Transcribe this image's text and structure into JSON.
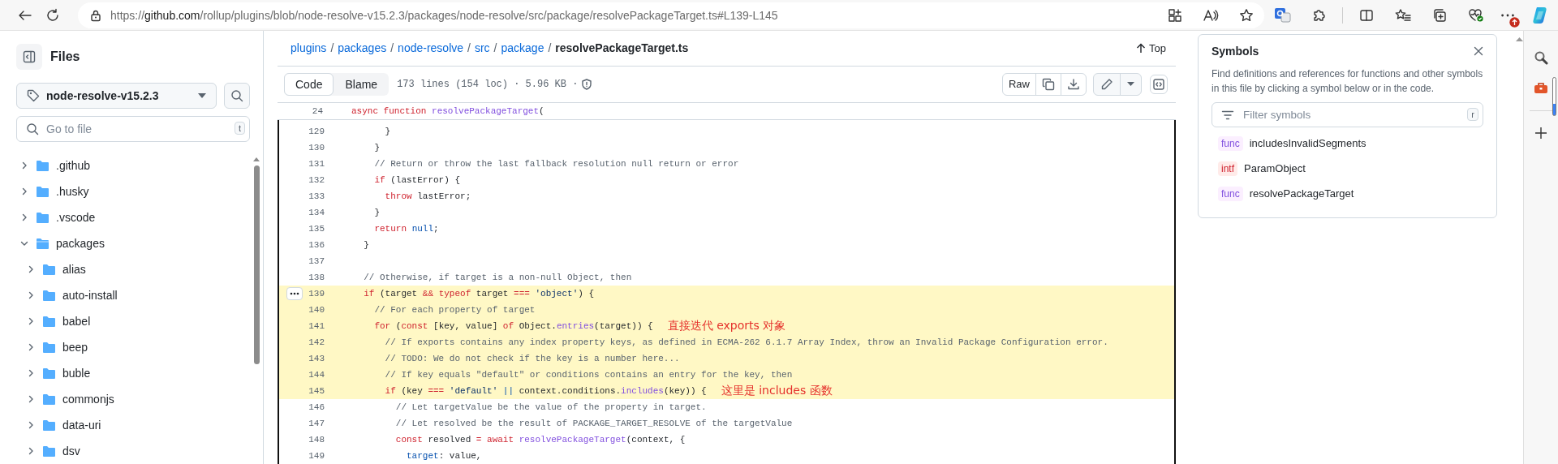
{
  "browser": {
    "url": {
      "scheme": "https://",
      "host": "github.com",
      "path": "/rollup/plugins/blob/node-resolve-v15.2.3/packages/node-resolve/src/package/resolvePackageTarget.ts#L139-L145"
    }
  },
  "sidebar": {
    "title": "Files",
    "branch": "node-resolve-v15.2.3",
    "search": {
      "placeholder": "Go to file",
      "shortcut": "t"
    },
    "tree": [
      {
        "name": ".github",
        "expanded": false
      },
      {
        "name": ".husky",
        "expanded": false
      },
      {
        "name": ".vscode",
        "expanded": false
      },
      {
        "name": "packages",
        "expanded": true,
        "children": [
          {
            "name": "alias",
            "expanded": false
          },
          {
            "name": "auto-install",
            "expanded": false
          },
          {
            "name": "babel",
            "expanded": false
          },
          {
            "name": "beep",
            "expanded": false
          },
          {
            "name": "buble",
            "expanded": false
          },
          {
            "name": "commonjs",
            "expanded": false
          },
          {
            "name": "data-uri",
            "expanded": false
          },
          {
            "name": "dsv",
            "expanded": false
          }
        ]
      }
    ]
  },
  "file": {
    "breadcrumb": [
      {
        "kind": "link",
        "text": "plugins"
      },
      {
        "kind": "separator",
        "text": "/"
      },
      {
        "kind": "link",
        "text": "packages"
      },
      {
        "kind": "separator",
        "text": "/"
      },
      {
        "kind": "link",
        "text": "node-resolve"
      },
      {
        "kind": "separator",
        "text": "/"
      },
      {
        "kind": "link",
        "text": "src"
      },
      {
        "kind": "separator",
        "text": "/"
      },
      {
        "kind": "link",
        "text": "package"
      },
      {
        "kind": "separator",
        "text": "/"
      },
      {
        "kind": "current",
        "text": "resolvePackageTarget.ts"
      }
    ],
    "top": "Top",
    "tabs": [
      {
        "label": "Code",
        "selected": true
      },
      {
        "label": "Blame",
        "selected": false
      }
    ],
    "info": "173 lines (154 loc) · 5.96 KB ·",
    "raw": "Raw",
    "sticky": {
      "number": "24",
      "tokens": [
        {
          "kind": "keyword",
          "text": "async "
        },
        {
          "kind": "keyword",
          "text": "function "
        },
        {
          "kind": "function",
          "text": "resolvePackageTarget"
        },
        {
          "kind": "plain",
          "text": "("
        }
      ]
    },
    "lines": [
      {
        "number": "129",
        "highlighted": false,
        "tokens": [
          {
            "kind": "plain",
            "text": "      }"
          }
        ]
      },
      {
        "number": "130",
        "highlighted": false,
        "tokens": [
          {
            "kind": "plain",
            "text": "    }"
          }
        ]
      },
      {
        "number": "131",
        "highlighted": false,
        "tokens": [
          {
            "kind": "comment",
            "text": "    // Return or throw the last fallback resolution null return or error"
          }
        ]
      },
      {
        "number": "132",
        "highlighted": false,
        "tokens": [
          {
            "kind": "keyword",
            "text": "    if"
          },
          {
            "kind": "plain",
            "text": " (lastError) {"
          }
        ]
      },
      {
        "number": "133",
        "highlighted": false,
        "tokens": [
          {
            "kind": "keyword",
            "text": "      throw"
          },
          {
            "kind": "plain",
            "text": " lastError;"
          }
        ]
      },
      {
        "number": "134",
        "highlighted": false,
        "tokens": [
          {
            "kind": "plain",
            "text": "    }"
          }
        ]
      },
      {
        "number": "135",
        "highlighted": false,
        "tokens": [
          {
            "kind": "keyword",
            "text": "    return "
          },
          {
            "kind": "constant",
            "text": "null"
          },
          {
            "kind": "plain",
            "text": ";"
          }
        ]
      },
      {
        "number": "136",
        "highlighted": false,
        "tokens": [
          {
            "kind": "plain",
            "text": "  }"
          }
        ]
      },
      {
        "number": "137",
        "highlighted": false
      },
      {
        "number": "138",
        "highlighted": false,
        "tokens": [
          {
            "kind": "comment",
            "text": "  // Otherwise, if target is a non-null Object, then"
          }
        ]
      },
      {
        "number": "139",
        "highlighted": true,
        "tokens": [
          {
            "kind": "keyword",
            "text": "  if"
          },
          {
            "kind": "plain",
            "text": " (target "
          },
          {
            "kind": "keyword",
            "text": "&& typeof"
          },
          {
            "kind": "plain",
            "text": " target "
          },
          {
            "kind": "keyword",
            "text": "=== "
          },
          {
            "kind": "string",
            "text": "'object'"
          },
          {
            "kind": "plain",
            "text": ") {"
          }
        ]
      },
      {
        "number": "140",
        "highlighted": true,
        "tokens": [
          {
            "kind": "comment",
            "text": "    // For each property of target"
          }
        ]
      },
      {
        "number": "141",
        "highlighted": true,
        "annotation": "直接迭代 exports 对象",
        "tokens": [
          {
            "kind": "keyword",
            "text": "    for"
          },
          {
            "kind": "plain",
            "text": " ("
          },
          {
            "kind": "keyword",
            "text": "const"
          },
          {
            "kind": "plain",
            "text": " [key, value] "
          },
          {
            "kind": "keyword",
            "text": "of"
          },
          {
            "kind": "plain",
            "text": " Object."
          },
          {
            "kind": "function",
            "text": "entries"
          },
          {
            "kind": "plain",
            "text": "(target)) {"
          }
        ]
      },
      {
        "number": "142",
        "highlighted": true,
        "tokens": [
          {
            "kind": "comment",
            "text": "      // If exports contains any index property keys, as defined in ECMA-262 6.1.7 Array Index, throw an Invalid Package Configuration error."
          }
        ]
      },
      {
        "number": "143",
        "highlighted": true,
        "tokens": [
          {
            "kind": "comment",
            "text": "      // TODO: We do not check if the key is a number here..."
          }
        ]
      },
      {
        "number": "144",
        "highlighted": true,
        "tokens": [
          {
            "kind": "comment",
            "text": "      // If key equals \"default\" or conditions contains an entry for the key, then"
          }
        ]
      },
      {
        "number": "145",
        "highlighted": true,
        "annotation": "这里是 includes 函数",
        "tokens": [
          {
            "kind": "keyword",
            "text": "      if"
          },
          {
            "kind": "plain",
            "text": " (key "
          },
          {
            "kind": "keyword",
            "text": "=== "
          },
          {
            "kind": "string",
            "text": "'default'"
          },
          {
            "kind": "constant",
            "text": " ||"
          },
          {
            "kind": "plain",
            "text": " context.conditions."
          },
          {
            "kind": "function",
            "text": "includes"
          },
          {
            "kind": "plain",
            "text": "(key)) {"
          }
        ]
      },
      {
        "number": "146",
        "highlighted": false,
        "tokens": [
          {
            "kind": "comment",
            "text": "        // Let targetValue be the value of the property in target."
          }
        ]
      },
      {
        "number": "147",
        "highlighted": false,
        "tokens": [
          {
            "kind": "comment",
            "text": "        // Let resolved be the result of PACKAGE_TARGET_RESOLVE of the targetValue"
          }
        ]
      },
      {
        "number": "148",
        "highlighted": false,
        "tokens": [
          {
            "kind": "keyword",
            "text": "        const"
          },
          {
            "kind": "plain",
            "text": " resolved "
          },
          {
            "kind": "keyword",
            "text": "= await "
          },
          {
            "kind": "function",
            "text": "resolvePackageTarget"
          },
          {
            "kind": "plain",
            "text": "(context, {"
          }
        ]
      },
      {
        "number": "149",
        "highlighted": false,
        "tokens": [
          {
            "kind": "constant",
            "text": "          target"
          },
          {
            "kind": "plain",
            "text": ": value,"
          }
        ]
      }
    ]
  },
  "symbols": {
    "title": "Symbols",
    "description": "Find definitions and references for functions and other symbols in this file by clicking a symbol below or in the code.",
    "filter": {
      "placeholder": "Filter symbols",
      "shortcut": "r"
    },
    "items": [
      {
        "kind": "func",
        "badge": "func",
        "name": "includesInvalidSegments"
      },
      {
        "kind": "intf",
        "badge": "intf",
        "name": "ParamObject"
      },
      {
        "kind": "func",
        "badge": "func",
        "name": "resolvePackageTarget"
      }
    ]
  }
}
